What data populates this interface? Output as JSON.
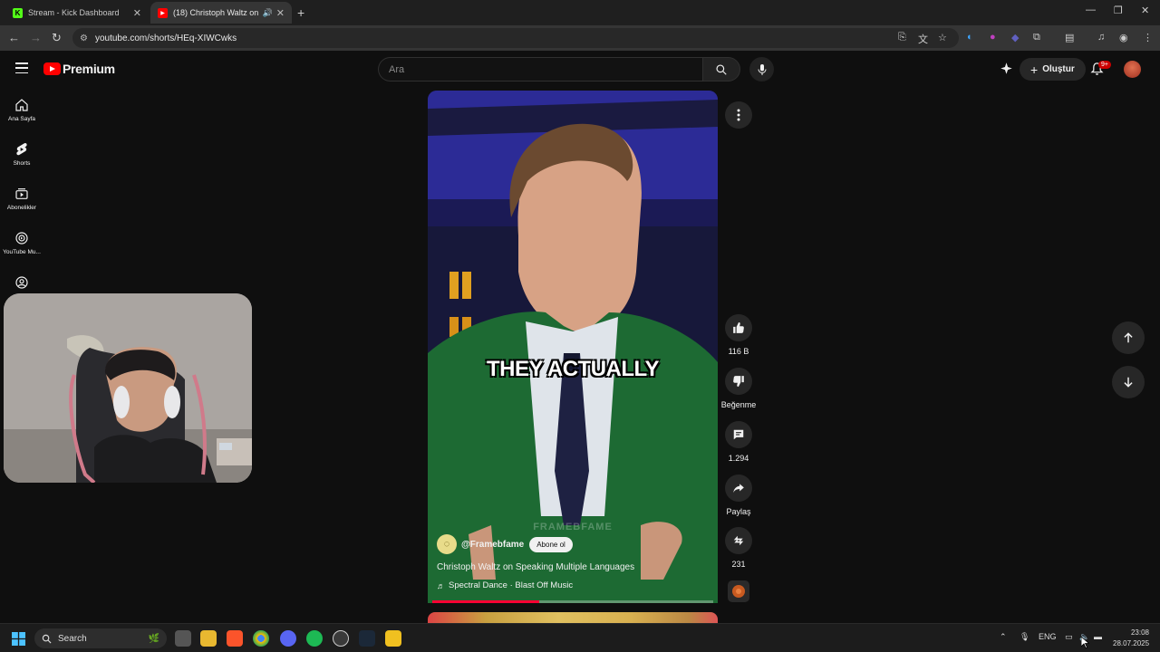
{
  "browser": {
    "tabs": [
      {
        "title": "Stream - Kick Dashboard",
        "active": false,
        "favicon": "kick-icon"
      },
      {
        "title": "(18) Christoph Waltz on Spe",
        "active": true,
        "favicon": "youtube-icon"
      }
    ],
    "url": "youtube.com/shorts/HEq-XIWCwks"
  },
  "header": {
    "logo_text": "Premium",
    "search_placeholder": "Ara",
    "create_label": "Oluştur",
    "notifications_badge": "9+"
  },
  "sidebar": {
    "items": [
      {
        "label": "Ana Sayfa",
        "icon": "home-icon"
      },
      {
        "label": "Shorts",
        "icon": "shorts-icon"
      },
      {
        "label": "Abonelikler",
        "icon": "subscriptions-icon"
      },
      {
        "label": "YouTube Mu...",
        "icon": "youtube-music-icon"
      },
      {
        "label": "",
        "icon": "account-icon"
      }
    ]
  },
  "short": {
    "caption": "THEY ACTUALLY",
    "watermark": "FRAMEBFAME",
    "channel": "@Framebfame",
    "subscribe_label": "Abone ol",
    "title": "Christoph Waltz on Speaking Multiple Languages",
    "music": "Spectral Dance · Blast Off Music",
    "progress_fraction": 0.38
  },
  "actions": {
    "likes": "116 B",
    "dislike_label": "Beğenme",
    "comments": "1.294",
    "share_label": "Paylaş",
    "remix_count": "231"
  },
  "taskbar": {
    "search_label": "Search",
    "language": "ENG",
    "time": "23:08",
    "date": "28.07.2025"
  },
  "colors": {
    "youtube_red": "#ff0000",
    "progress_red": "#ff0033",
    "background": "#0f0f0f"
  }
}
